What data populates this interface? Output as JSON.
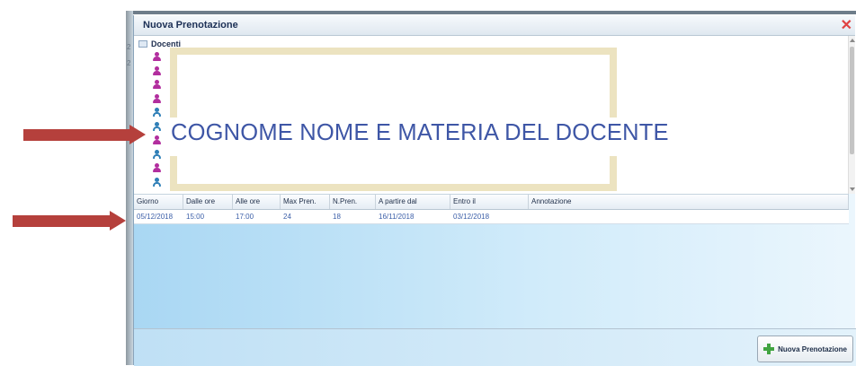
{
  "window": {
    "title": "Nuova Prenotazione",
    "close_glyph": "✕"
  },
  "tree": {
    "root_label": "Docenti",
    "teachers": [
      "female",
      "female",
      "female",
      "female",
      "male",
      "male",
      "female",
      "male",
      "female",
      "male"
    ],
    "overlay_text": "COGNOME NOME E MATERIA DEL DOCENTE"
  },
  "grid": {
    "headers": [
      "Giorno",
      "Dalle ore",
      "Alle ore",
      "Max Pren.",
      "N.Pren.",
      "A partire dal",
      "Entro il",
      "Annotazione"
    ],
    "row": [
      "05/12/2018",
      "15:00",
      "17:00",
      "24",
      "18",
      "16/11/2018",
      "03/12/2018",
      ""
    ]
  },
  "footer": {
    "new_booking_label": "Nuova Prenotazione"
  },
  "background": {
    "edge_marks": [
      "2",
      "2"
    ]
  },
  "colors": {
    "arrow": "#b5403c",
    "banner_text": "#3e56a6",
    "female_icon": "#b22e9e",
    "male_icon": "#2f7fb7"
  }
}
